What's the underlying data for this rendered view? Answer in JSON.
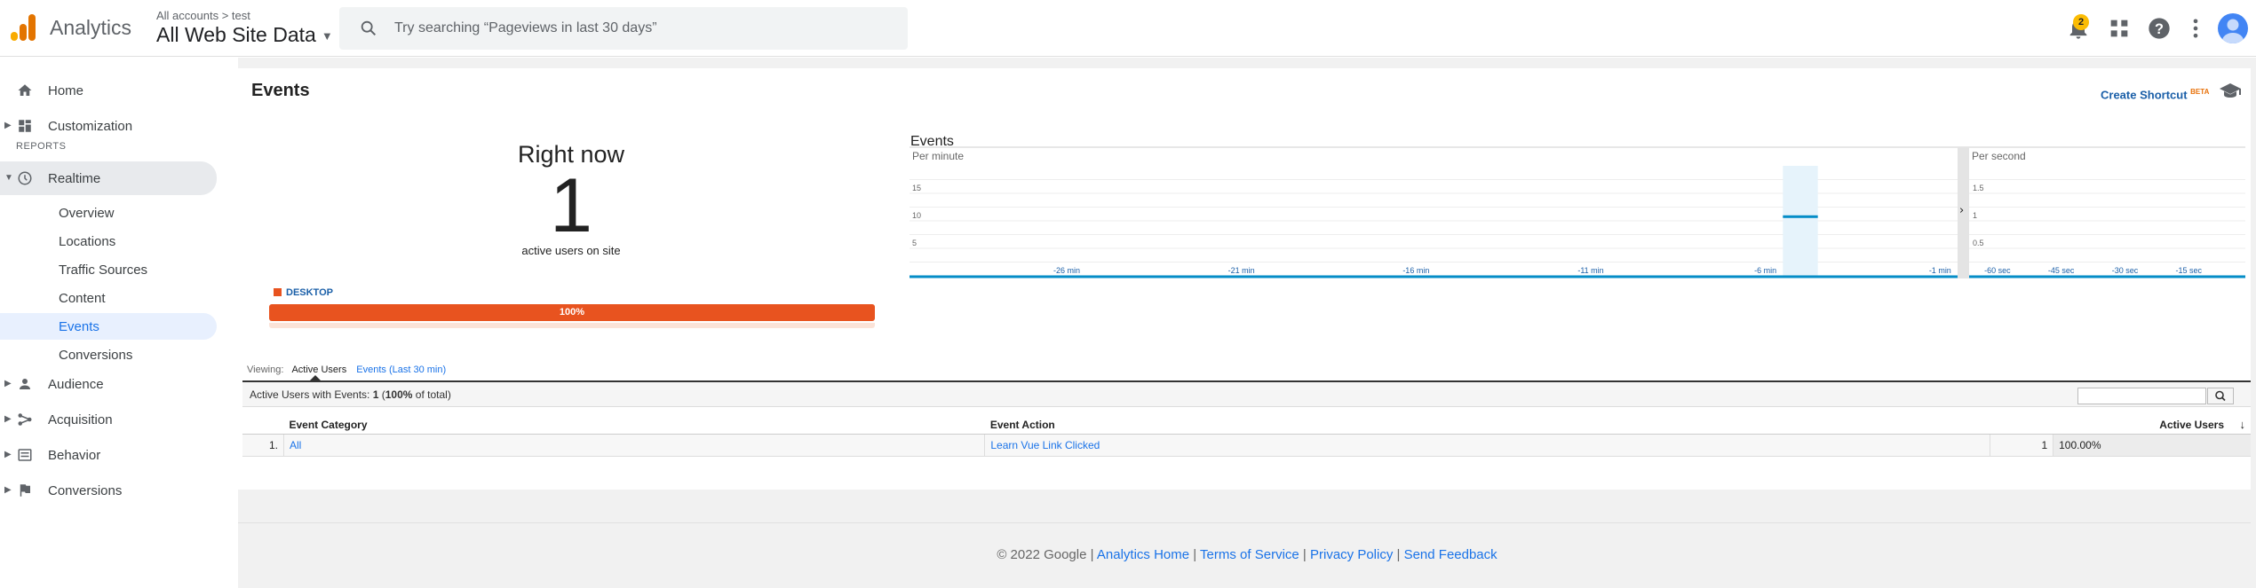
{
  "header": {
    "app_title": "Analytics",
    "breadcrumb": "All accounts > test",
    "property": "All Web Site Data",
    "search_placeholder": "Try searching “Pageviews in last 30 days”",
    "notification_count": "2"
  },
  "sidebar": {
    "home": "Home",
    "customization": "Customization",
    "reports_header": "REPORTS",
    "realtime": "Realtime",
    "realtime_items": [
      "Overview",
      "Locations",
      "Traffic Sources",
      "Content",
      "Events",
      "Conversions"
    ],
    "audience": "Audience",
    "acquisition": "Acquisition",
    "behavior": "Behavior",
    "conversions": "Conversions"
  },
  "report": {
    "title": "Events",
    "create_shortcut": "Create Shortcut",
    "beta": "BETA",
    "right_now": {
      "title": "Right now",
      "count": "1",
      "subtitle": "active users on site",
      "device_label": "DESKTOP",
      "device_percent_label": "100%",
      "device_share": 1.0
    },
    "viewing": {
      "label": "Viewing:",
      "active_tab": "Active Users",
      "other_tab": "Events (Last 30 min)"
    },
    "summary": {
      "prefix": "Active Users with Events:",
      "count": "1",
      "detail_bold": "100%",
      "detail_suffix": "of total"
    },
    "table": {
      "headers": [
        "Event Category",
        "Event Action",
        "Active Users"
      ],
      "rows": [
        {
          "index": "1.",
          "category": "All",
          "action": "Learn Vue Link Clicked",
          "users": "1",
          "percent": "100.00%"
        }
      ]
    }
  },
  "chart_data": [
    {
      "type": "bar",
      "title": "Events",
      "subtitle": "Per minute",
      "x_tick_labels": [
        "-26 min",
        "-21 min",
        "-16 min",
        "-11 min",
        "-6 min",
        "-1 min"
      ],
      "y_tick_labels": [
        "5",
        "10",
        "15"
      ],
      "ylim": [
        0,
        20
      ],
      "x": [
        -30,
        -29,
        -28,
        -27,
        -26,
        -25,
        -24,
        -23,
        -22,
        -21,
        -20,
        -19,
        -18,
        -17,
        -16,
        -15,
        -14,
        -13,
        -12,
        -11,
        -10,
        -9,
        -8,
        -7,
        -6,
        -5,
        -4,
        -3,
        -2,
        -1
      ],
      "values": [
        0,
        0,
        0,
        0,
        0,
        0,
        0,
        0,
        0,
        0,
        0,
        0,
        0,
        0,
        0,
        0,
        0,
        0,
        0,
        0,
        0,
        0,
        0,
        0,
        0,
        11,
        0,
        0,
        0,
        0
      ],
      "highlight_x": -5,
      "accent_color": "#058dc7"
    },
    {
      "type": "bar",
      "subtitle": "Per second",
      "x_tick_labels": [
        "-60 sec",
        "-45 sec",
        "-30 sec",
        "-15 sec"
      ],
      "y_tick_labels": [
        "0.5",
        "1",
        "1.5"
      ],
      "ylim": [
        0,
        2
      ],
      "values": [],
      "accent_color": "#058dc7"
    }
  ],
  "footer": {
    "copyright": "© 2022 Google",
    "links": [
      "Analytics Home",
      "Terms of Service",
      "Privacy Policy",
      "Send Feedback"
    ]
  }
}
